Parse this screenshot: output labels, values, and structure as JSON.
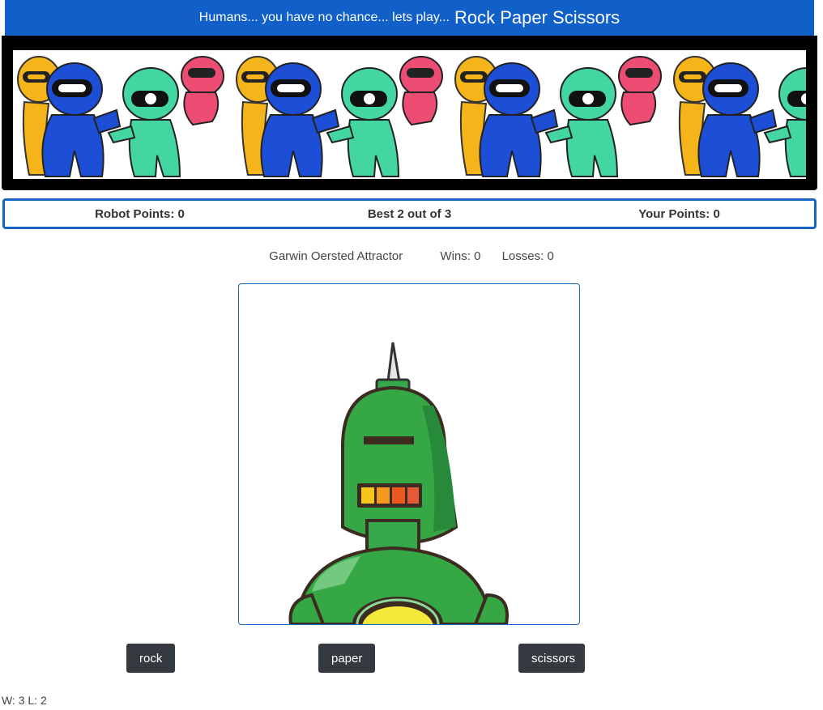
{
  "header": {
    "tagline": "Humans... you have no chance... lets play...",
    "title": "Rock Paper Scissors",
    "bg_color": "#1160c9"
  },
  "banner": {
    "image": "cartoon-robots-banner",
    "robot_colors": [
      "#f5b41a",
      "#1d4fd6",
      "#43d6a0",
      "#ee4d73"
    ]
  },
  "scoreboard": {
    "robot_points": "Robot Points: 0",
    "format": "Best 2 out of 3",
    "your_points": "Your Points: 0",
    "border_color": "#1565c0"
  },
  "opponent": {
    "name": "Garwin Oersted Attractor",
    "wins": "Wins: 0",
    "losses": "Losses: 0",
    "image": "green-robot-portrait"
  },
  "actions": {
    "rock": "rock",
    "paper": "paper",
    "scissors": "scissors"
  },
  "footer": {
    "record": "W: 3 L: 2"
  }
}
